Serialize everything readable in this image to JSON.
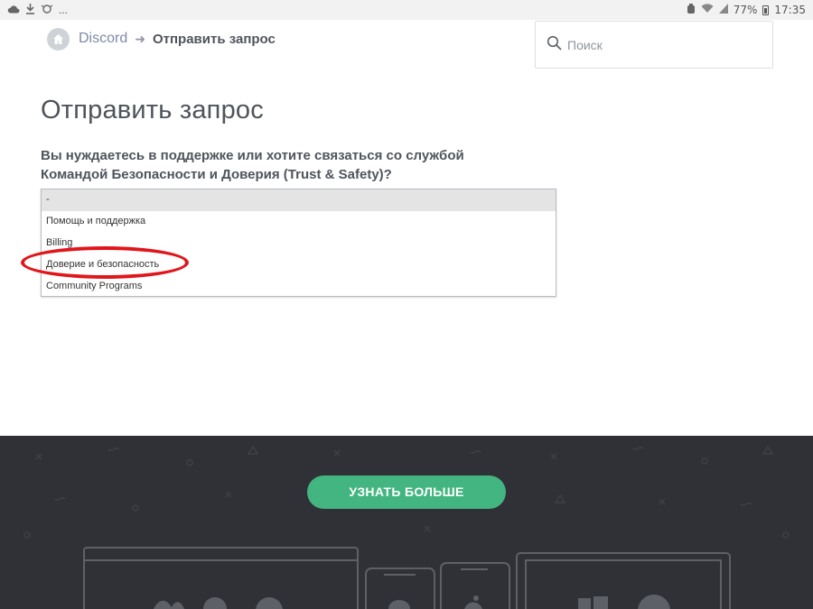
{
  "status_bar": {
    "battery": "77%",
    "time": "17:35",
    "notif_more": "..."
  },
  "breadcrumb": {
    "home_link": "Discord",
    "current": "Отправить запрос"
  },
  "search": {
    "placeholder": "Поиск"
  },
  "page": {
    "title": "Отправить запрос",
    "question": "Вы нуждаетесь в поддержке или хотите связаться со службой Командой Безопасности и Доверия (Trust & Safety)?"
  },
  "dropdown": {
    "options": [
      {
        "label": "-",
        "selected": true
      },
      {
        "label": "Помощь и поддержка",
        "selected": false
      },
      {
        "label": "Billing",
        "selected": false
      },
      {
        "label": "Доверие и безопасность",
        "selected": false
      },
      {
        "label": "Community Programs",
        "selected": false
      }
    ]
  },
  "footer": {
    "cta_label": "УЗНАТЬ БОЛЬШЕ"
  },
  "colors": {
    "accent_green": "#43b581",
    "footer_bg": "#2f3136",
    "annotation_red": "#e0161b"
  }
}
